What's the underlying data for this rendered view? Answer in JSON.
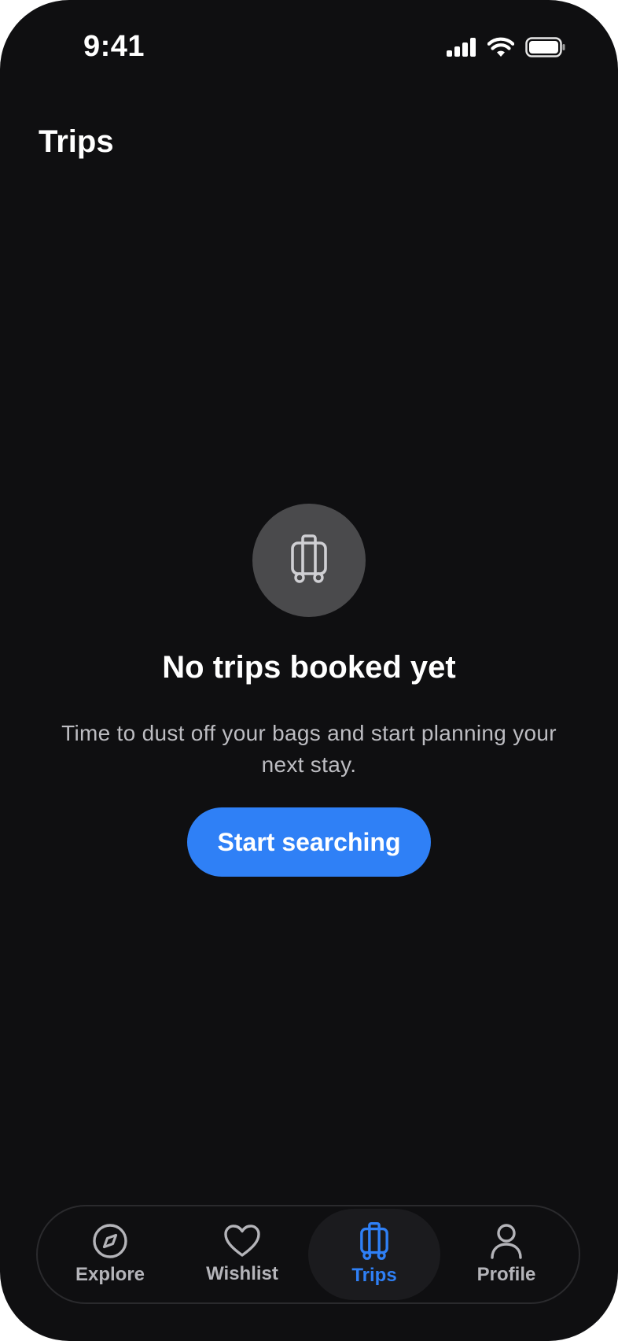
{
  "status_bar": {
    "time": "9:41"
  },
  "header": {
    "title": "Trips"
  },
  "empty_state": {
    "icon": "luggage-icon",
    "title": "No trips booked yet",
    "subtitle": "Time to dust off your bags and start planning your next stay.",
    "cta_label": "Start searching"
  },
  "tabs": [
    {
      "label": "Explore",
      "icon": "compass-icon",
      "active": false
    },
    {
      "label": "Wishlist",
      "icon": "heart-icon",
      "active": false
    },
    {
      "label": "Trips",
      "icon": "luggage-icon",
      "active": true
    },
    {
      "label": "Profile",
      "icon": "person-icon",
      "active": false
    }
  ],
  "colors": {
    "background": "#0f0f11",
    "accent": "#2f80f6",
    "icon_circle": "#4a4a4c",
    "inactive_tab": "#b4b4b9"
  }
}
